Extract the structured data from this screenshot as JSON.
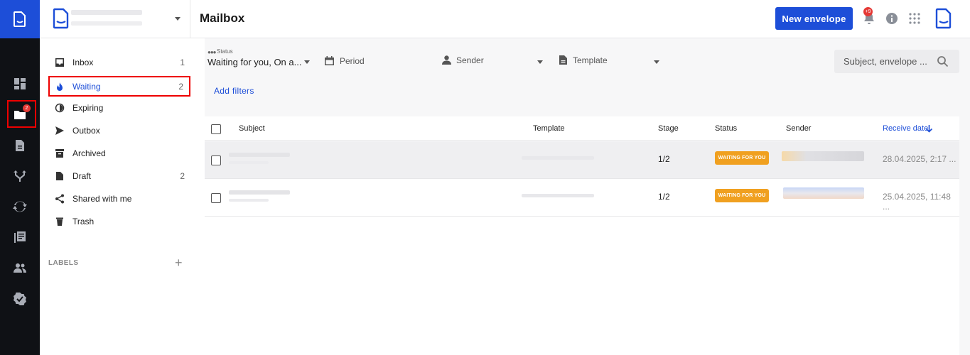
{
  "header": {
    "title": "Mailbox",
    "new_envelope_label": "New envelope",
    "notification_count": "+9"
  },
  "rail": {
    "mailbox_badge": "2"
  },
  "sidebar": {
    "items": [
      {
        "label": "Inbox",
        "count": "1"
      },
      {
        "label": "Waiting",
        "count": "2"
      },
      {
        "label": "Expiring",
        "count": ""
      },
      {
        "label": "Outbox",
        "count": ""
      },
      {
        "label": "Archived",
        "count": ""
      },
      {
        "label": "Draft",
        "count": "2"
      },
      {
        "label": "Shared with me",
        "count": ""
      },
      {
        "label": "Trash",
        "count": ""
      }
    ],
    "labels_header": "LABELS",
    "labels_add": "+"
  },
  "filters": {
    "status_label": "Status",
    "status_value": "Waiting for you, On a...",
    "period_label": "Period",
    "sender_label": "Sender",
    "template_label": "Template",
    "search_placeholder": "Subject, envelope ...",
    "add_filters_label": "Add filters"
  },
  "table": {
    "columns": {
      "subject": "Subject",
      "template": "Template",
      "stage": "Stage",
      "status": "Status",
      "sender": "Sender",
      "receive_date": "Receive date"
    },
    "rows": [
      {
        "stage": "1/2",
        "status": "WAITING FOR YOU",
        "receive_date": "28.04.2025, 2:17 ..."
      },
      {
        "stage": "1/2",
        "status": "WAITING FOR YOU",
        "receive_date": "25.04.2025, 11:48 ..."
      }
    ]
  },
  "colors": {
    "accent": "#1d4ed8",
    "rail_bg": "#0f1115",
    "status_waiting": "#f0a020",
    "badge": "#e53935"
  }
}
